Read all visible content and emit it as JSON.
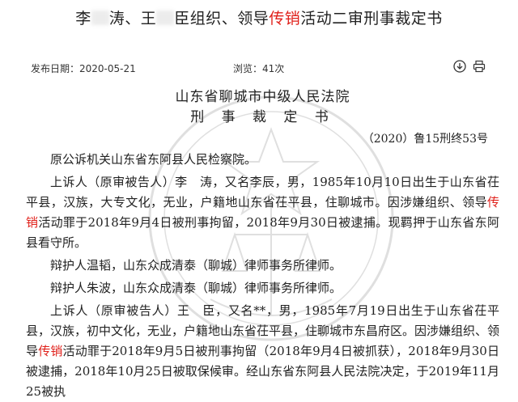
{
  "header": {
    "title_part1": "李",
    "title_part2": "涛、王",
    "title_part3": "臣组织、领导",
    "title_highlight": "传销",
    "title_part4": "活动二审刑事裁定书"
  },
  "meta": {
    "date_label": "发布日期：",
    "date_value": "2020-05-21",
    "views_label": "浏览：",
    "views_value": "41次",
    "icons": [
      "download-icon",
      "print-icon"
    ]
  },
  "document": {
    "court": "山东省聊城市中级人民法院",
    "doc_type": "刑 事 裁 定 书",
    "case_no": "（2020）鲁15刑终53号",
    "p1": "原公诉机关山东省东阿县人民检察院。",
    "p2_a": "上诉人（原审被告人）李　涛，又名李辰，男，1985年10月10日出生于山东省茌平县，汉族，大专文化，无业，户籍地山东省茌平县，住聊城市。因涉嫌组织、领导",
    "p2_hl": "传销",
    "p2_b": "活动罪于2018年9月4日被刑事拘留，2018年9月30日被逮捕。现羁押于山东省东阿县看守所。",
    "p3": "辩护人温韬，山东众成清泰（聊城）律师事务所律师。",
    "p4": "辩护人朱波，山东众成清泰（聊城）律师事务所律师。",
    "p5_a": "上诉人（原审被告人）王　臣，又名**，男，1985年7月19日出生于山东省茌平县，汉族，初中文化，无业，户籍地山东省茌平县，住聊城市东昌府区。因涉嫌组织、领导",
    "p5_hl": "传销",
    "p5_b": "活动罪于2018年9月5日被刑事拘留（2018年9月4日被抓获），2018年9月30日被逮捕，2018年10月25日被取保候审。经山东省东阿县人民法院决定，于2019年11月25被执"
  },
  "colors": {
    "highlight": "#e0201a",
    "text": "#222222"
  }
}
